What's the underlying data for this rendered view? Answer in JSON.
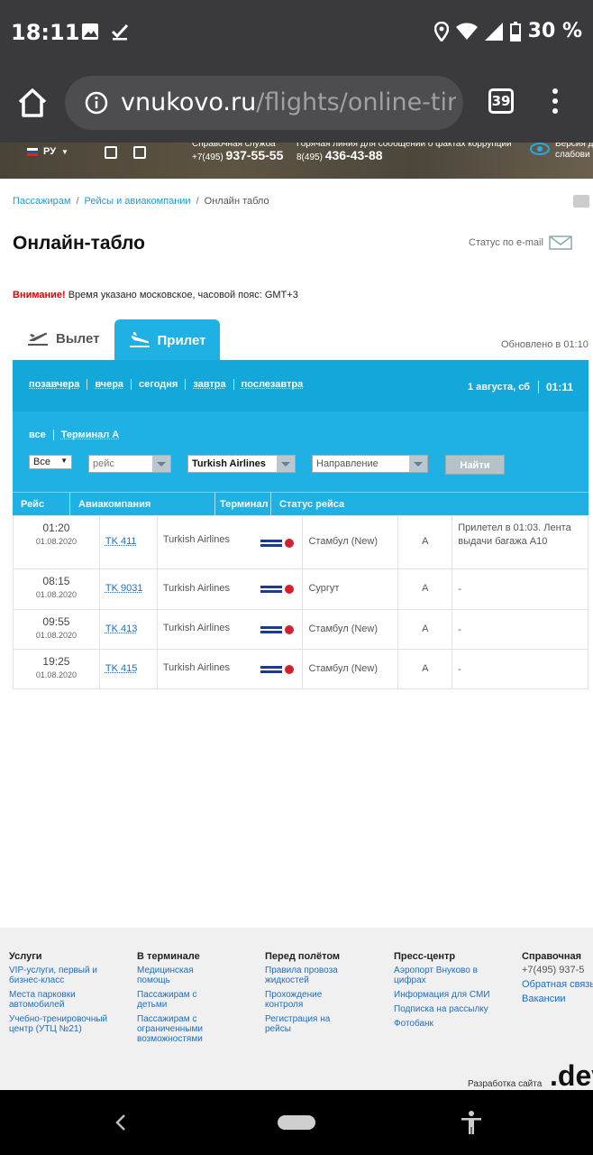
{
  "status_bar": {
    "time": "18:11",
    "battery": "30 %"
  },
  "browser": {
    "url_host": "vnukovo.ru",
    "url_path": "/flights/online-time",
    "tab_count": "39"
  },
  "site_header": {
    "lang": "РУ",
    "help_label": "Справочная служба",
    "help_prefix": "+7(495)",
    "help_number": "937-55-55",
    "hotline_label": "Горячая линия для сообщений о фактах коррупции",
    "hotline_prefix": "8(495)",
    "hotline_number": "436-43-88",
    "version_l1": "Версия д",
    "version_l2": "слабови"
  },
  "breadcrumb": {
    "item1": "Пассажирам",
    "item2": "Рейсы и авиакомпании",
    "item3": "Онлайн табло"
  },
  "page": {
    "title": "Онлайн-табло",
    "email_status": "Статус по e-mail",
    "notice_bold": "Внимание!",
    "notice_text": " Время указано московское, часовой пояс: GMT+3"
  },
  "tabs": {
    "departure": "Вылет",
    "arrival": "Прилет",
    "updated": "Обновлено в 01:10"
  },
  "days": {
    "d1": "позавчера",
    "d2": "вчера",
    "d3": "сегодня",
    "d4": "завтра",
    "d5": "послезавтра"
  },
  "current": {
    "date": "1 августа, сб",
    "time": "01:11"
  },
  "terminals": {
    "all": "все",
    "a": "Терминал А"
  },
  "filters": {
    "scope": "Все",
    "flight_placeholder": "рейс",
    "airline": "Turkish Airlines",
    "direction": "Направление",
    "find": "Найти"
  },
  "columns": {
    "flight": "Рейс",
    "airline": "Авиакомпания",
    "terminal": "Терминал",
    "status": "Статус рейса"
  },
  "flights": [
    {
      "time": "01:20",
      "date": "01.08.2020",
      "flight": "TK 411",
      "airline": "Turkish Airlines",
      "direction": "Стамбул (New)",
      "terminal": "A",
      "status": "Прилетел в 01:03. Лента выдачи багажа А10"
    },
    {
      "time": "08:15",
      "date": "01.08.2020",
      "flight": "TK 9031",
      "airline": "Turkish Airlines",
      "direction": "Сургут",
      "terminal": "A",
      "status": "-"
    },
    {
      "time": "09:55",
      "date": "01.08.2020",
      "flight": "TK 413",
      "airline": "Turkish Airlines",
      "direction": "Стамбул (New)",
      "terminal": "A",
      "status": "-"
    },
    {
      "time": "19:25",
      "date": "01.08.2020",
      "flight": "TK 415",
      "airline": "Turkish Airlines",
      "direction": "Стамбул (New)",
      "terminal": "A",
      "status": "-"
    }
  ],
  "footer": {
    "services": {
      "title": "Услуги",
      "l1": "VIP-услуги, первый и бизнес-класс",
      "l2": "Места парковки автомобилей",
      "l3": "Учебно-тренировочный центр (УТЦ №21)"
    },
    "terminal": {
      "title": "В терминале",
      "l1": "Медицинская помощь",
      "l2": "Пассажирам с детьми",
      "l3": "Пассажирам с ограниченными возможностями"
    },
    "before": {
      "title": "Перед полётом",
      "l1": "Правила провоза жидкостей",
      "l2": "Прохождение контроля",
      "l3": "Регистрация на рейсы"
    },
    "press": {
      "title": "Пресс-центр",
      "l1": "Аэропорт Внуково в цифрах",
      "l2": "Информация для СМИ",
      "l3": "Подписка на рассылку",
      "l4": "Фотобанк"
    },
    "info": {
      "title": "Справочная",
      "phone": "+7(495) 937-5",
      "l1": "Обратная связь",
      "l2": "Вакансии"
    },
    "dev_label": "Разработка сайта",
    "dev_logo": ".dev"
  }
}
